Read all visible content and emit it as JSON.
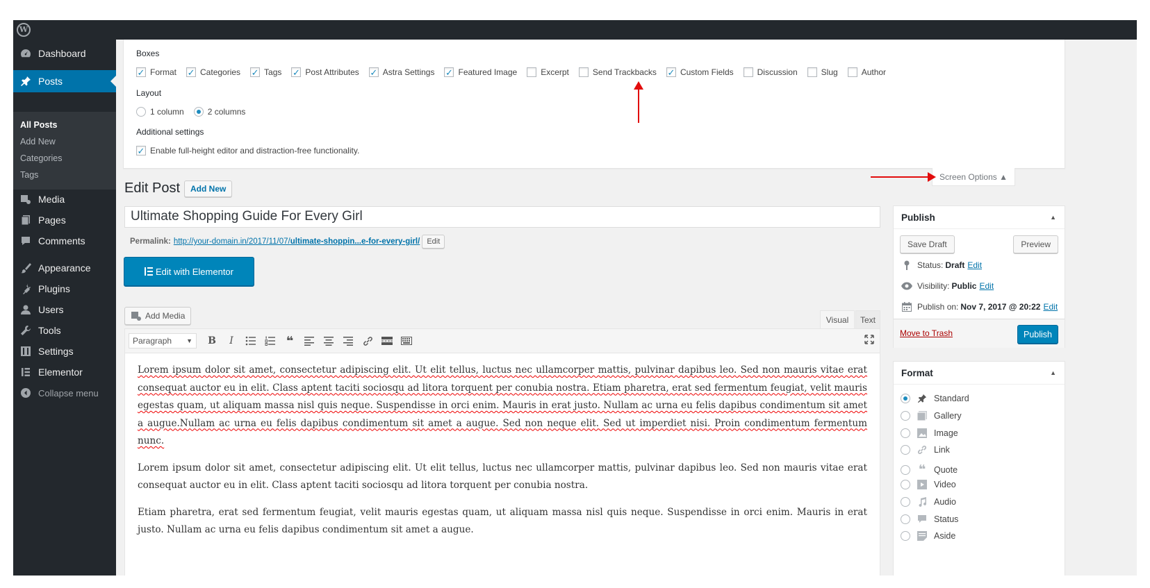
{
  "sidebar": {
    "items": [
      {
        "label": "Dashboard",
        "icon": "dashboard-icon"
      },
      {
        "label": "Posts",
        "icon": "pin-icon"
      },
      {
        "label": "Media",
        "icon": "media-icon"
      },
      {
        "label": "Pages",
        "icon": "pages-icon"
      },
      {
        "label": "Comments",
        "icon": "comments-icon"
      },
      {
        "label": "Appearance",
        "icon": "brush-icon"
      },
      {
        "label": "Plugins",
        "icon": "plugin-icon"
      },
      {
        "label": "Users",
        "icon": "user-icon"
      },
      {
        "label": "Tools",
        "icon": "wrench-icon"
      },
      {
        "label": "Settings",
        "icon": "settings-icon"
      },
      {
        "label": "Elementor",
        "icon": "elementor-icon"
      }
    ],
    "submenu": [
      "All Posts",
      "Add New",
      "Categories",
      "Tags"
    ],
    "collapse_label": "Collapse menu"
  },
  "screen_options": {
    "boxes_heading": "Boxes",
    "boxes": [
      {
        "label": "Format",
        "checked": true
      },
      {
        "label": "Categories",
        "checked": true
      },
      {
        "label": "Tags",
        "checked": true
      },
      {
        "label": "Post Attributes",
        "checked": true
      },
      {
        "label": "Astra Settings",
        "checked": true
      },
      {
        "label": "Featured Image",
        "checked": true
      },
      {
        "label": "Excerpt",
        "checked": false
      },
      {
        "label": "Send Trackbacks",
        "checked": false
      },
      {
        "label": "Custom Fields",
        "checked": true
      },
      {
        "label": "Discussion",
        "checked": false
      },
      {
        "label": "Slug",
        "checked": false
      },
      {
        "label": "Author",
        "checked": false
      }
    ],
    "layout_heading": "Layout",
    "layout_options": [
      {
        "label": "1 column",
        "checked": false
      },
      {
        "label": "2 columns",
        "checked": true
      }
    ],
    "additional_heading": "Additional settings",
    "additional_label": "Enable full-height editor and distraction-free functionality.",
    "tab_label": "Screen Options ▲"
  },
  "editor": {
    "page_title": "Edit Post",
    "add_new": "Add New",
    "post_title": "Ultimate Shopping Guide For Every Girl",
    "permalink_label": "Permalink:",
    "permalink_base": "http://your-domain.in/2017/11/07/",
    "permalink_slug": "ultimate-shoppin...e-for-every-girl/",
    "permalink_edit": "Edit",
    "elementor_button": "Edit with Elementor",
    "add_media": "Add Media",
    "tab_visual": "Visual",
    "tab_text": "Text",
    "format_select": "Paragraph",
    "paragraphs": [
      "Lorem ipsum dolor sit amet, consectetur adipiscing elit. Ut elit tellus, luctus nec ullamcorper mattis, pulvinar dapibus leo. Sed non mauris vitae erat consequat auctor eu in elit. Class aptent taciti sociosqu ad litora torquent per conubia nostra. Etiam pharetra, erat sed fermentum feugiat, velit mauris egestas quam, ut aliquam massa nisl quis neque. Suspendisse in orci enim. Mauris in erat justo. Nullam ac urna eu felis dapibus condimentum sit amet a augue.Nullam ac urna eu felis dapibus condimentum sit amet a augue. Sed non neque elit. Sed ut imperdiet nisi. Proin condimentum fermentum nunc.",
      "Lorem ipsum dolor sit amet, consectetur adipiscing elit. Ut elit tellus, luctus nec ullamcorper mattis, pulvinar dapibus leo. Sed non mauris vitae erat consequat auctor eu in elit. Class aptent taciti sociosqu ad litora torquent per conubia nostra.",
      "Etiam pharetra, erat sed fermentum feugiat, velit mauris egestas quam, ut aliquam massa nisl quis neque. Suspendisse in orci enim. Mauris in erat justo. Nullam ac urna eu felis dapibus condimentum sit amet a augue."
    ]
  },
  "publish": {
    "title": "Publish",
    "save_draft": "Save Draft",
    "preview": "Preview",
    "status_label": "Status:",
    "status_value": "Draft",
    "visibility_label": "Visibility:",
    "visibility_value": "Public",
    "publish_on_label": "Publish on:",
    "publish_on_value": "Nov 7, 2017 @ 20:22",
    "edit_link": "Edit",
    "move_to_trash": "Move to Trash",
    "publish_button": "Publish"
  },
  "format_box": {
    "title": "Format",
    "options": [
      {
        "label": "Standard",
        "icon": "pin-icon",
        "checked": true
      },
      {
        "label": "Gallery",
        "icon": "gallery-icon",
        "checked": false
      },
      {
        "label": "Image",
        "icon": "image-icon",
        "checked": false
      },
      {
        "label": "Link",
        "icon": "link-icon",
        "checked": false
      },
      {
        "label": "Quote",
        "icon": "quote-icon",
        "checked": false
      },
      {
        "label": "Video",
        "icon": "video-icon",
        "checked": false
      },
      {
        "label": "Audio",
        "icon": "audio-icon",
        "checked": false
      },
      {
        "label": "Status",
        "icon": "status-icon",
        "checked": false
      },
      {
        "label": "Aside",
        "icon": "aside-icon",
        "checked": false
      }
    ]
  },
  "colors": {
    "admin_dark": "#23282d",
    "accent_blue": "#0073aa",
    "button_blue": "#0085ba",
    "annotation_red": "#e20c0c"
  }
}
